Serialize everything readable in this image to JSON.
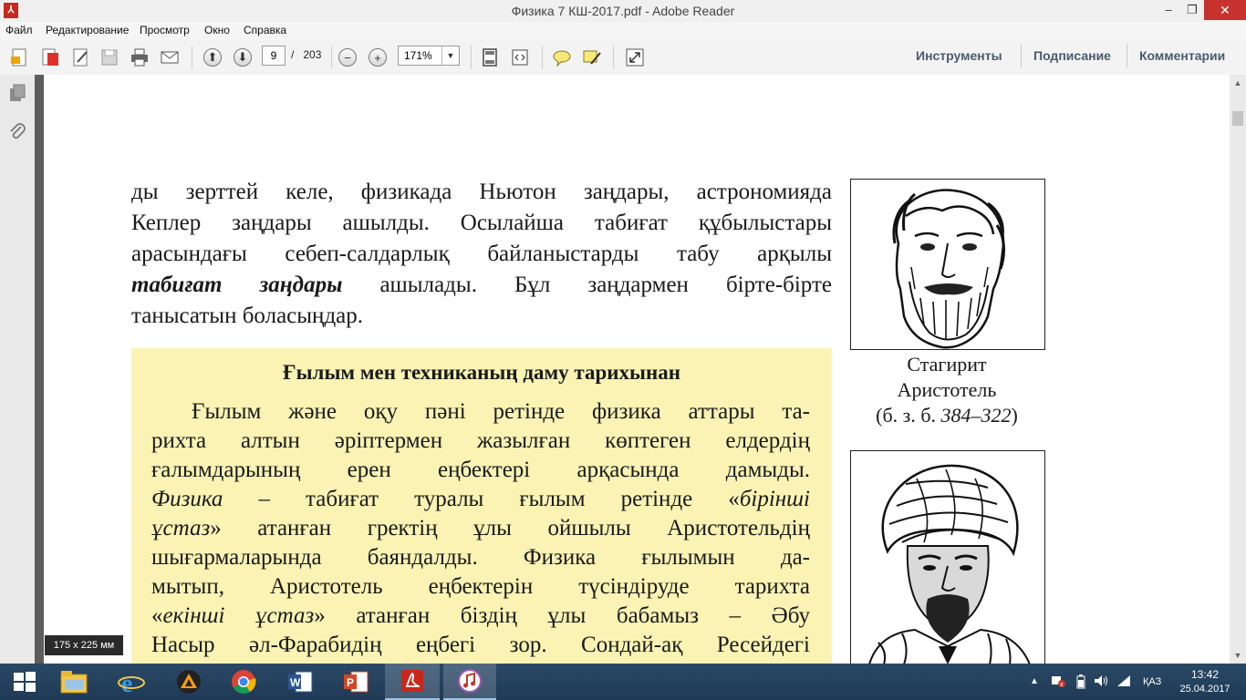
{
  "window": {
    "title": "Физика 7 КШ-2017.pdf - Adobe Reader",
    "minimize_glyph": "–",
    "restore_glyph": "❐",
    "close_glyph": "✕"
  },
  "menu": [
    "Файл",
    "Редактирование",
    "Просмотр",
    "Окно",
    "Справка"
  ],
  "toolbar": {
    "page_current": "9",
    "page_separator": "/",
    "page_total": "203",
    "zoom": "171%",
    "right_links": [
      "Инструменты",
      "Подписание",
      "Комментарии"
    ]
  },
  "document": {
    "para1_lines": [
      "ды зерттей келе, физикада Ньютон заңдары, астрономияда",
      "Кеплер заңдары ашылды. Осылайша табиғат құбылыстары",
      "арасындағы себеп-салдарлық байланыстарды табу арқылы"
    ],
    "para1_bold_term": "табиғат заңдары",
    "para1_line4_rest": " ашылады. Бұл заңдармен бірте-бірте",
    "para1_line5": "танысатын боласыңдар.",
    "history_title": "Ғылым мен техниканың даму тарихынан",
    "history_lines": [
      "Ғылым және оқу пәні ретінде физика аттары та-",
      "рихта алтын әріптермен жазылған көптеген елдердің",
      "ғалымдарының ерен еңбектері арқасында дамыды."
    ],
    "history_line4_ital": "Физика",
    "history_line4_mid": " – табиғат туралы ғылым ретінде «",
    "history_line4_ital2": "бірінші",
    "history_line5_ital": "ұстаз",
    "history_line5_rest": "» атанған гректің ұлы ойшылы Аристотельдің",
    "history_line6": "шығармаларында баяндалды. Физика ғылымын да-",
    "history_line7": "мытып, Аристотель еңбектерін түсіндіруде тарихта",
    "history_line8_open": "«",
    "history_line8_ital": "екінші ұстаз",
    "history_line8_rest": "» атанған біздің ұлы бабамыз – Әбу",
    "history_line9": "Насыр әл-Фарабидің еңбегі зор. Сондай-ақ Ресейдегі",
    "caption1_line1": "Стагирит",
    "caption1_line2": "Аристотель",
    "caption1_line3_open": "(б. з. б. ",
    "caption1_line3_ital": "384–322",
    "caption1_line3_close": ")"
  },
  "tooltip": "175 x 225 мм",
  "taskbar": {
    "apps": [
      "start",
      "file-explorer",
      "internet-explorer",
      "aimp",
      "chrome",
      "word",
      "powerpoint",
      "adobe-reader",
      "itunes"
    ],
    "lang": "ҚАЗ",
    "time": "13:42",
    "date": "25.04.2017"
  },
  "colors": {
    "history_bg": "#fbf3b4",
    "taskbar_bg": "#1f3a56",
    "close_red": "#c7312e",
    "link_blue_grey": "#4a5a6e"
  }
}
